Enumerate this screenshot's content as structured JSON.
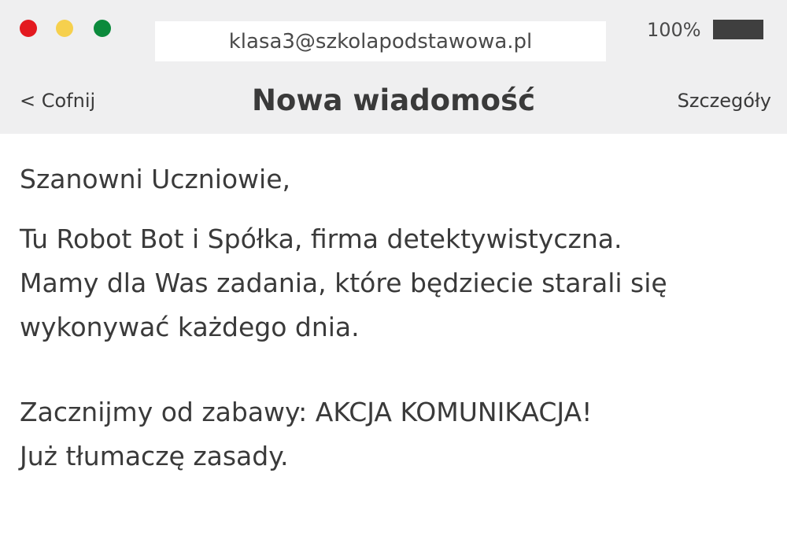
{
  "window": {
    "controls": {
      "close_color": "#e3191f",
      "minimize_color": "#f6d04d",
      "maximize_color": "#0b8a3c"
    },
    "address": "klasa3@szkolapodstawowa.pl",
    "battery": {
      "label": "100%",
      "level": 1.0
    }
  },
  "nav": {
    "back_label": "< Cofnij",
    "title": "Nowa wiadomość",
    "details_label": "Szczegóły"
  },
  "message": {
    "greeting": "Szanowni Uczniowie,",
    "paragraph1": [
      "Tu Robot Bot i Spółka, firma detektywistyczna.",
      "Mamy dla Was zadania, które będziecie starali się",
      "wykonywać każdego dnia."
    ],
    "paragraph2": [
      "Zacznijmy od zabawy: AKCJA KOMUNIKACJA!",
      "Już tłumaczę zasady."
    ]
  }
}
